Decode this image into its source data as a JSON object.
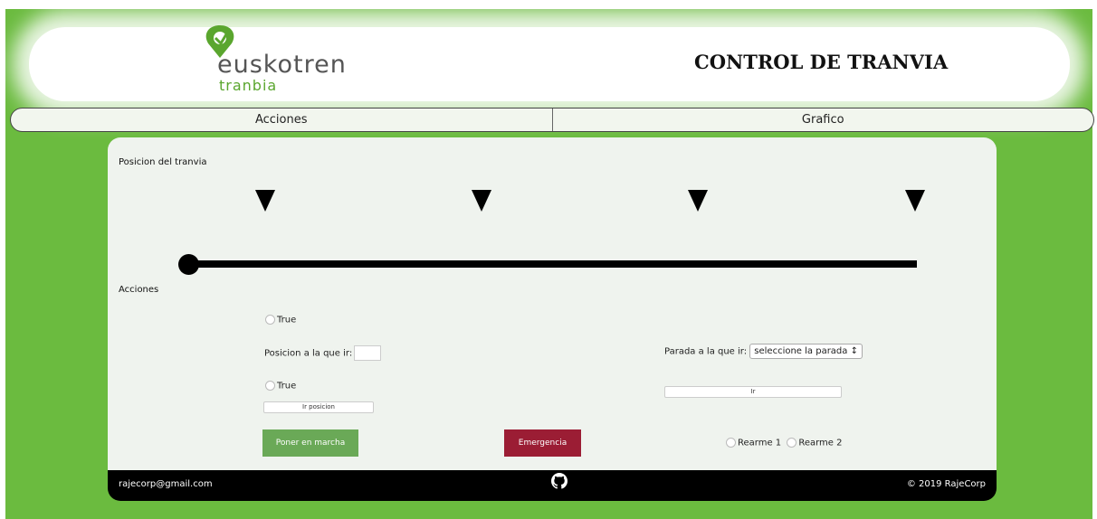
{
  "brand": {
    "name": "euskotren",
    "sub": "tranbia",
    "green": "#6bbb3f",
    "logo_icon": "euskotren-logo-icon"
  },
  "header": {
    "title": "CONTROL DE TRANVIA"
  },
  "nav": {
    "tabs": [
      {
        "label": "Acciones"
      },
      {
        "label": "Grafico"
      }
    ]
  },
  "position": {
    "label": "Posicion del tranvia",
    "markers": 4,
    "slider_value": 0
  },
  "actions": {
    "label": "Acciones",
    "radio1_label": "True",
    "position_label": "Posicion a la que ir:",
    "position_value": "",
    "radio2_label": "True",
    "go_position_label": "Ir posicion",
    "stop_label": "Parada a la que ir:",
    "stop_select": "seleccione la parada ↕",
    "go_label": "Ir",
    "start_label": "Poner en marcha",
    "start_color": "#6aa957",
    "emergency_label": "Emergencia",
    "emergency_color": "#9b1d34",
    "rearm1_label": "Rearme 1",
    "rearm2_label": "Rearme 2"
  },
  "footer": {
    "email": "rajecorp@gmail.com",
    "copyright": "© 2019 RajeCorp",
    "github_icon": "github-icon"
  }
}
